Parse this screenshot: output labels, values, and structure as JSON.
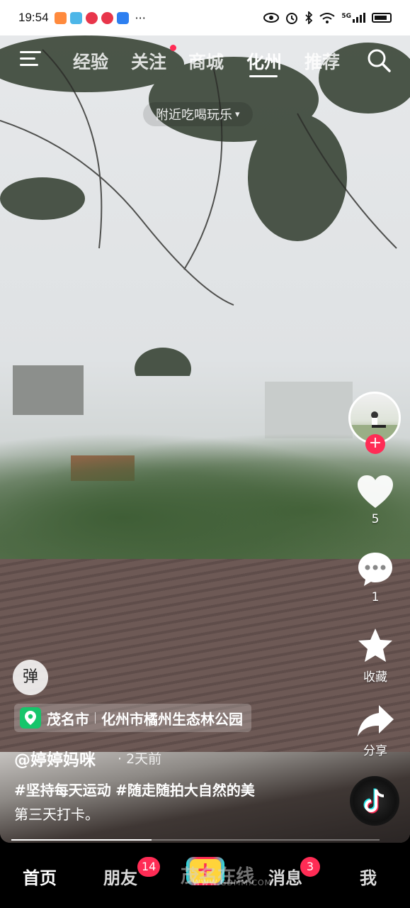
{
  "status_bar": {
    "time": "19:54",
    "more": "···",
    "network": "5G"
  },
  "top_nav": {
    "tabs": [
      {
        "label": "经验"
      },
      {
        "label": "关注"
      },
      {
        "label": "商城"
      },
      {
        "label": "化州"
      },
      {
        "label": "推荐"
      }
    ],
    "active_tab": "化州",
    "nearby_pill": "附近吃喝玩乐",
    "nearby_arrow": "▾"
  },
  "right_rail": {
    "likes": "5",
    "comments": "1",
    "favorite_label": "收藏",
    "share_label": "分享",
    "follow_symbol": "+"
  },
  "danmu_label": "弹",
  "location": {
    "city": "茂名市",
    "place": "化州市橘州生态林公园"
  },
  "post": {
    "author": "@婷婷妈咪",
    "time": "· 2天前",
    "hashtag1": "#坚持每天运动",
    "hashtag2": "#随走随拍大自然的美",
    "text": "第三天打卡。"
  },
  "playback_progress": 0.38,
  "bottom_nav": {
    "home": "首页",
    "friends": "朋友",
    "friends_badge": "14",
    "create_symbol": "+",
    "messages": "消息",
    "messages_badge": "3",
    "me": "我"
  },
  "watermark": {
    "main": "茂名在线",
    "url": "WWW.GDMM.COM"
  },
  "colors": {
    "accent": "#ff2c55",
    "location_pin": "#16c56b",
    "create_button": "#ffd43a"
  }
}
